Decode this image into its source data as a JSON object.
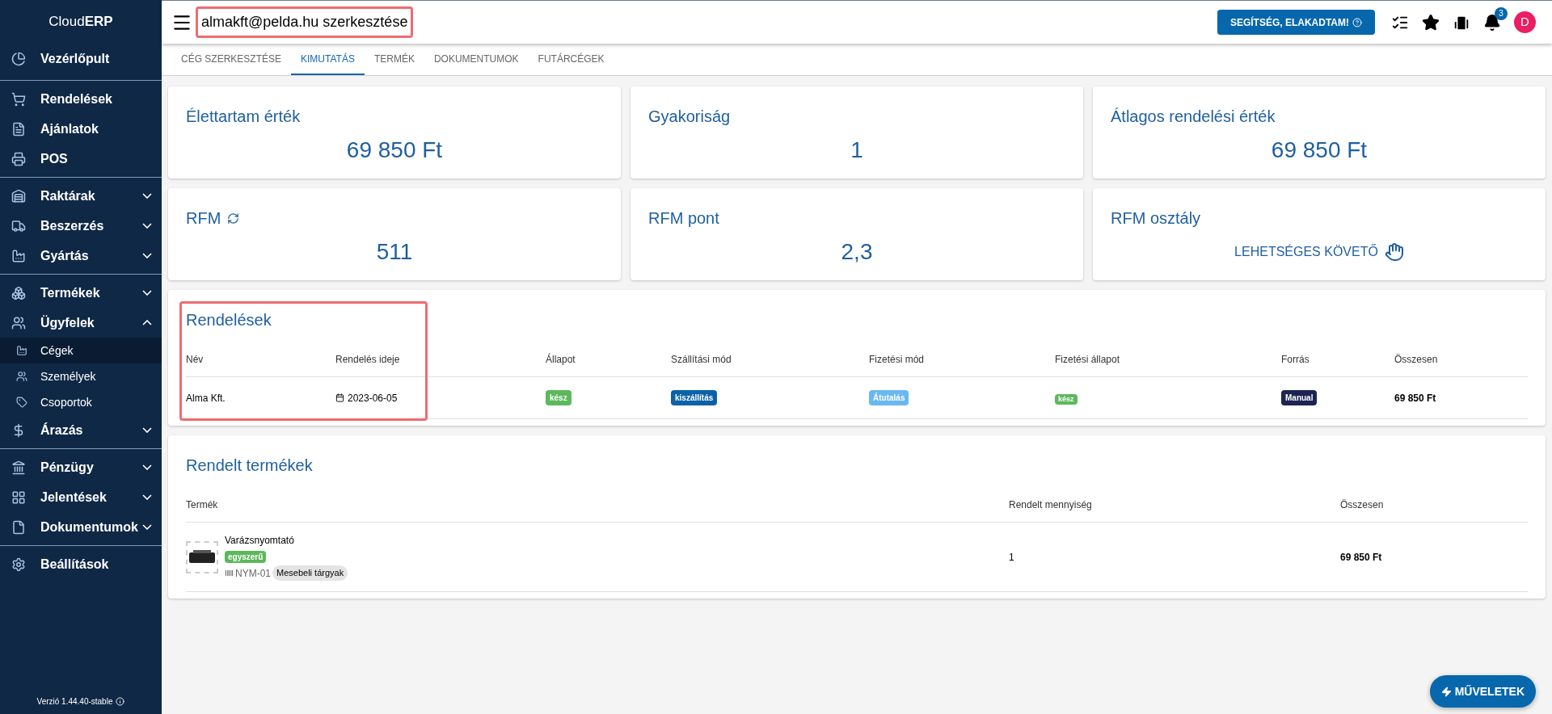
{
  "sidebar": {
    "brand": {
      "light": "Cloud",
      "bold": "ERP"
    },
    "groups": [
      [
        {
          "label": "Vezérlőpult",
          "selected": false
        }
      ],
      [
        {
          "label": "Rendelések",
          "selected": false
        },
        {
          "label": "Ajánlatok",
          "selected": false
        },
        {
          "label": "POS",
          "selected": false
        }
      ],
      [
        {
          "label": "Raktárak",
          "selected": false,
          "expanded": false
        },
        {
          "label": "Beszerzés",
          "selected": false,
          "expanded": false
        },
        {
          "label": "Gyártás",
          "selected": false,
          "expanded": false
        }
      ],
      [
        {
          "label": "Termékek",
          "selected": false,
          "expanded": false
        },
        {
          "label": "Ügyfelek",
          "selected": false,
          "expanded": true,
          "children": [
            {
              "label": "Cégek",
              "selected": true
            },
            {
              "label": "Személyek",
              "selected": false
            },
            {
              "label": "Csoportok",
              "selected": false
            }
          ]
        },
        {
          "label": "Árazás",
          "selected": false,
          "expanded": false
        }
      ],
      [
        {
          "label": "Pénzügy",
          "selected": false,
          "expanded": false
        },
        {
          "label": "Jelentések",
          "selected": false,
          "expanded": false
        },
        {
          "label": "Dokumentumok",
          "selected": false,
          "expanded": false
        }
      ],
      [
        {
          "label": "Beállítások",
          "selected": false
        }
      ]
    ],
    "version": "Verzió 1.44.40-stable"
  },
  "header": {
    "title": "almakft@pelda.hu szerkesztése",
    "title_highlighted": true,
    "help_button": "SEGÍTSÉG, ELAKADTAM!",
    "notification_count": "3",
    "avatar": "D"
  },
  "tabs": [
    {
      "label": "CÉG SZERKESZTÉSE",
      "selected": false
    },
    {
      "label": "KIMUTATÁS",
      "selected": true
    },
    {
      "label": "TERMÉK",
      "selected": false
    },
    {
      "label": "DOKUMENTUMOK",
      "selected": false
    },
    {
      "label": "FUTÁRCÉGEK",
      "selected": false
    }
  ],
  "stats": [
    {
      "kind": "value",
      "title": "Élettartam érték",
      "value": "69 850 Ft"
    },
    {
      "kind": "value",
      "title": "Gyakoriság",
      "value": "1"
    },
    {
      "kind": "value",
      "title": "Átlagos rendelési érték",
      "value": "69 850 Ft"
    },
    {
      "kind": "refresh",
      "title": "RFM",
      "value": "511"
    },
    {
      "kind": "value",
      "title": "RFM pont",
      "value": "2,3"
    },
    {
      "kind": "class",
      "title": "RFM osztály",
      "value": "LEHETSÉGES KÖVETŐ"
    }
  ],
  "orders": {
    "title": "Rendelések",
    "highlighted": true,
    "columns": [
      "Név",
      "Rendelés ideje",
      "Állapot",
      "Szállítási mód",
      "Fizetési mód",
      "Fizetési állapot",
      "Forrás",
      "Összesen"
    ],
    "rows": [
      {
        "name": "Alma Kft.",
        "date": "2023-06-05",
        "badges": [
          {
            "text": "kész",
            "color": "#5cb85c"
          },
          {
            "text": "kiszállítás",
            "color": "#0b62a8"
          },
          {
            "text": "Átutalás",
            "color": "#6ab8f0"
          },
          {
            "text": "kész",
            "color": "#5cb85c"
          },
          {
            "text": "Manual",
            "color": "#1b2452"
          }
        ],
        "total": "69 850 Ft"
      }
    ]
  },
  "products": {
    "title": "Rendelt termékek",
    "columns": [
      "Termék",
      "Rendelt mennyiség",
      "Összesen"
    ],
    "rows": [
      {
        "name": "Varázsnyomtató",
        "type": "egyszerű",
        "sku": "NYM-01",
        "category": "Mesebeli tárgyak",
        "quantity": "1",
        "total": "69 850 Ft"
      }
    ]
  },
  "actions_button": "MŰVELETEK"
}
